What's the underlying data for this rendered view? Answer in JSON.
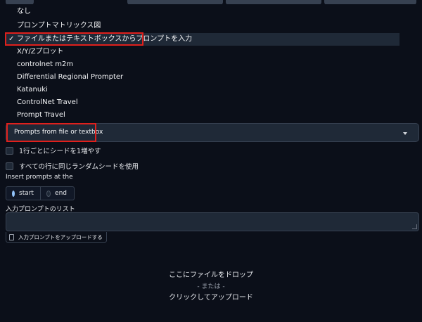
{
  "script_menu": {
    "items": [
      {
        "label": "なし",
        "checked": false
      },
      {
        "label": "プロンプトマトリックス図",
        "checked": false
      },
      {
        "label": "ファイルまたはテキストボックスからプロンプトを入力",
        "checked": true
      },
      {
        "label": "X/Y/Zプロット",
        "checked": false
      },
      {
        "label": "controlnet m2m",
        "checked": false
      },
      {
        "label": "Differential Regional Prompter",
        "checked": false
      },
      {
        "label": "Katanuki",
        "checked": false
      },
      {
        "label": "ControlNet Travel",
        "checked": false
      },
      {
        "label": "Prompt Travel",
        "checked": false
      }
    ],
    "check_mark": "✓"
  },
  "script_dropdown": {
    "value": "Prompts from file or textbox"
  },
  "options": {
    "iterate_seed_label": "1行ごとにシードを1増やす",
    "same_random_seed_label": "すべての行に同じランダムシードを使用"
  },
  "insert_position": {
    "label": "Insert prompts at the",
    "options": [
      {
        "label": "start",
        "selected": true
      },
      {
        "label": "end",
        "selected": false
      }
    ]
  },
  "prompt_list": {
    "label": "入力プロンプトのリスト",
    "value": "",
    "upload_button_label": "入力プロンプトをアップロードする"
  },
  "drop_zone": {
    "line1": "ここにファイルをドロップ",
    "line2": "- または -",
    "line3": "クリックしてアップロード"
  },
  "colors": {
    "background": "#0b0f19",
    "highlight": "#e0201c",
    "radio_selected": "#2563eb"
  }
}
